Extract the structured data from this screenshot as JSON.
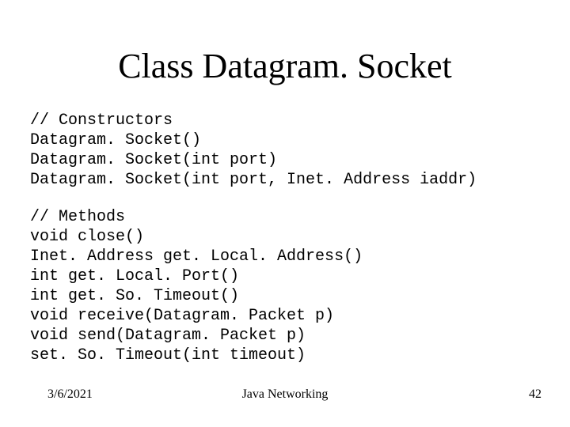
{
  "slide": {
    "title": "Class Datagram. Socket",
    "constructors": {
      "heading": "// Constructors",
      "lines": [
        "Datagram. Socket()",
        "Datagram. Socket(int port)",
        "Datagram. Socket(int port, Inet. Address iaddr)"
      ]
    },
    "methods": {
      "heading": "// Methods",
      "lines": [
        "void close()",
        "Inet. Address get. Local. Address()",
        "int get. Local. Port()",
        "int get. So. Timeout()",
        "void receive(Datagram. Packet p)",
        "void send(Datagram. Packet p)",
        "set. So. Timeout(int timeout)"
      ]
    },
    "footer": {
      "date": "3/6/2021",
      "title": "Java Networking",
      "page": "42"
    }
  }
}
